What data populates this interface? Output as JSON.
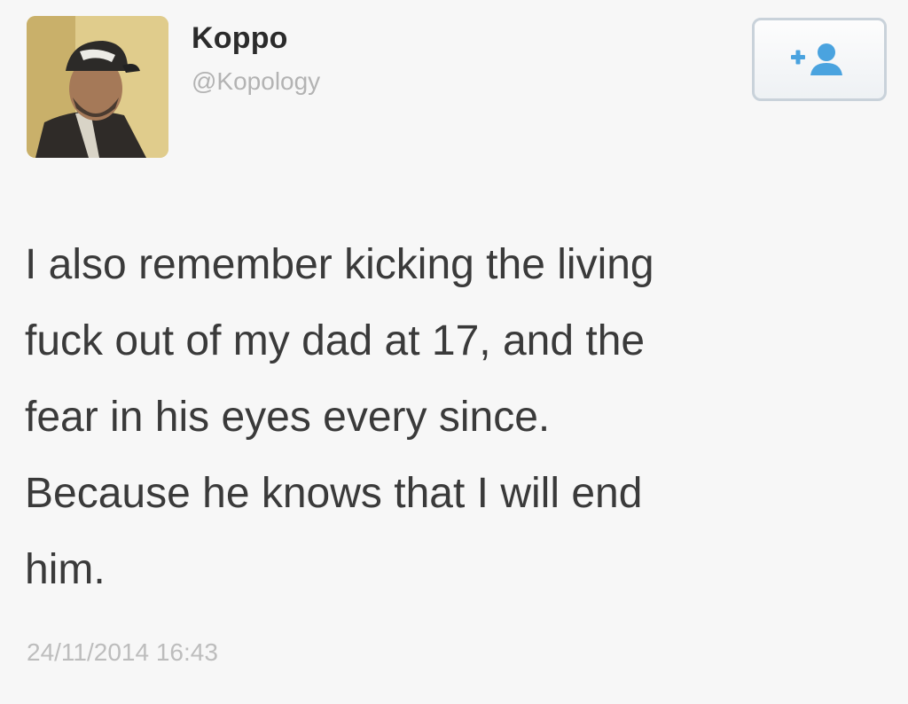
{
  "user": {
    "display_name": "Koppo",
    "handle": "@Kopology"
  },
  "follow_button": {
    "icon": "add-user-icon",
    "color": "#4aa3df"
  },
  "tweet": {
    "text": "I also remember kicking the living\nfuck out of my dad at 17, and the\nfear in his eyes every since.\nBecause he knows that I will end\nhim.",
    "timestamp": "24/11/2014 16:43"
  }
}
